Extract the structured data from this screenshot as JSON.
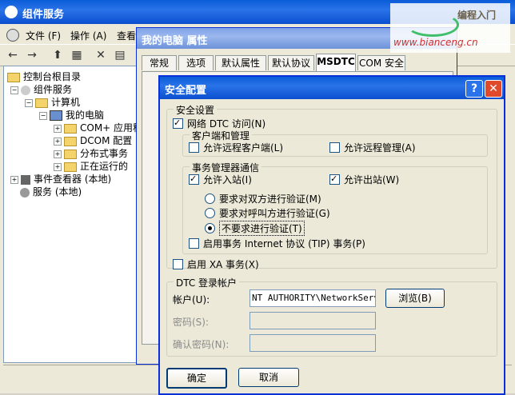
{
  "main_window": {
    "title": "组件服务",
    "menus": [
      "文件 (F)",
      "操作 (A)",
      "查看"
    ],
    "tree": [
      {
        "label": "控制台根目录",
        "level": 0
      },
      {
        "label": "组件服务",
        "level": 1
      },
      {
        "label": "计算机",
        "level": 2
      },
      {
        "label": "我的电脑",
        "level": 3
      },
      {
        "label": "COM+ 应用程",
        "level": 4
      },
      {
        "label": "DCOM 配置",
        "level": 4
      },
      {
        "label": "分布式事务",
        "level": 4
      },
      {
        "label": "正在运行的",
        "level": 4
      },
      {
        "label": "事件查看器 (本地)",
        "level": 1
      },
      {
        "label": "服务 (本地)",
        "level": 1
      }
    ]
  },
  "props_window": {
    "title": "我的电脑 属性",
    "tabs": [
      "常规",
      "选项",
      "默认属性",
      "默认协议",
      "MSDTC",
      "COM 安全"
    ],
    "active_tab": "MSDTC"
  },
  "security_dialog": {
    "title": "安全配置",
    "security_settings_legend": "安全设置",
    "network_dtc_access": {
      "label": "网络 DTC 访问(N)",
      "checked": true
    },
    "client_admin_legend": "客户端和管理",
    "allow_remote_clients": {
      "label": "允许远程客户端(L)",
      "checked": false
    },
    "allow_remote_admin": {
      "label": "允许远程管理(A)",
      "checked": false
    },
    "tm_comm_legend": "事务管理器通信",
    "allow_inbound": {
      "label": "允许入站(I)",
      "checked": true
    },
    "allow_outbound": {
      "label": "允许出站(W)",
      "checked": true
    },
    "radio_mutual": {
      "label": "要求对双方进行验证(M)",
      "checked": false
    },
    "radio_incoming": {
      "label": "要求对呼叫方进行验证(G)",
      "checked": false
    },
    "radio_none": {
      "label": "不要求进行验证(T)",
      "checked": true
    },
    "enable_tip": {
      "label": "启用事务 Internet 协议 (TIP) 事务(P)",
      "checked": false
    },
    "enable_xa": {
      "label": "启用 XA 事务(X)",
      "checked": false
    },
    "logon_legend": "DTC 登录帐户",
    "account_label": "帐户(U):",
    "account_value": "NT AUTHORITY\\NetworkService",
    "browse_button": "浏览(B)",
    "password_label": "密码(S):",
    "confirm_label": "确认密码(N):",
    "ok_button": "确定",
    "cancel_button": "取消"
  },
  "watermark": {
    "top": "编程入门",
    "bottom": "www.bianceng.cn"
  },
  "colors": {
    "title_active": "#0a5cd8",
    "title_inactive": "#7ea2e6",
    "close_red": "#e04a2a"
  }
}
